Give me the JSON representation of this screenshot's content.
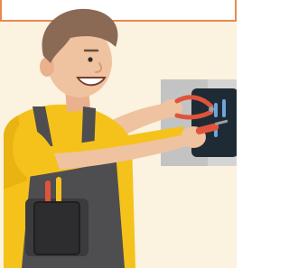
{
  "image": {
    "subject": "electrician-illustration",
    "colors": {
      "frame_border": "#e8894f",
      "background": "#fbf2df",
      "skin": "#efc2a0",
      "hair": "#8b6a55",
      "shirt": "#f5c21b",
      "overalls": "#4e4e50",
      "outlet_plate": "#c9c9c9",
      "outlet_dark": "#1e2b34",
      "tool_red": "#e0533a",
      "tool_blue": "#6ea6da"
    }
  }
}
